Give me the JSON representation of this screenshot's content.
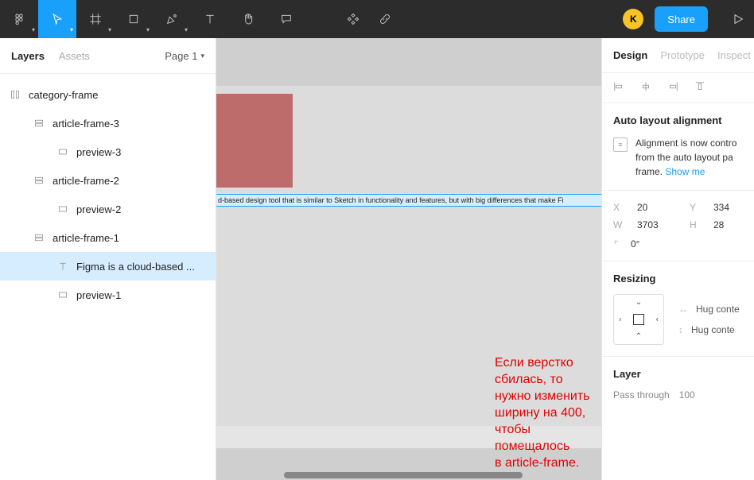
{
  "toolbar": {
    "share_label": "Share",
    "avatar_initial": "K"
  },
  "left": {
    "tab_layers": "Layers",
    "tab_assets": "Assets",
    "page_label": "Page 1",
    "tree": {
      "root": "category-frame",
      "a3": "article-frame-3",
      "p3": "preview-3",
      "a2": "article-frame-2",
      "p2": "preview-2",
      "a1": "article-frame-1",
      "sel": "Figma is a cloud-based ...",
      "p1": "preview-1"
    }
  },
  "canvas": {
    "text_strip": "d-based design tool that is similar to Sketch in functionality and features, but with big differences that make Fi",
    "annot_line1": "Если верстко сбилась, то нужно изменить",
    "annot_line2": "ширину на 400, чтобы помещалось",
    "annot_line3": "в article-frame."
  },
  "right": {
    "tab_design": "Design",
    "tab_prototype": "Prototype",
    "tab_inspect": "Inspect",
    "auto_title": "Auto layout alignment",
    "auto_info_1": "Alignment is now contro",
    "auto_info_2": "from the auto layout pa",
    "auto_info_3": "frame.",
    "auto_link": "Show me",
    "x_label": "X",
    "x_val": "20",
    "y_label": "Y",
    "y_val": "334",
    "w_label": "W",
    "w_val": "3703",
    "h_label": "H",
    "h_val": "28",
    "rot_val": "0°",
    "resize_title": "Resizing",
    "hug_a": "Hug conte",
    "hug_b": "Hug conte",
    "layer_title": "Layer",
    "layer_mode": "Pass through",
    "layer_opacity": "100"
  }
}
